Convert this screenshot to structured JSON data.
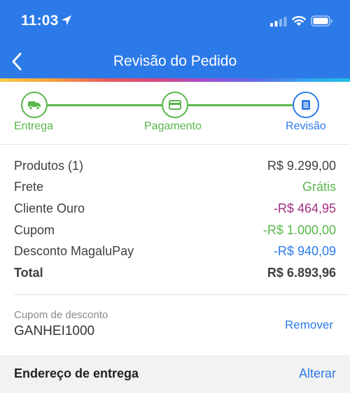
{
  "status_bar": {
    "time": "11:03",
    "icons": [
      "location-arrow-icon",
      "signal-icon",
      "wifi-icon",
      "battery-icon"
    ]
  },
  "header": {
    "title": "Revisão do Pedido",
    "back_icon": "chevron-left-icon",
    "background_color": "#2c7ae8"
  },
  "steps": [
    {
      "label": "Entrega",
      "icon": "truck-icon",
      "state": "done"
    },
    {
      "label": "Pagamento",
      "icon": "credit-card-icon",
      "state": "done"
    },
    {
      "label": "Revisão",
      "icon": "document-icon",
      "state": "current"
    }
  ],
  "summary": {
    "rows": [
      {
        "label": "Produtos (1)",
        "value": "R$ 9.299,00",
        "color": "#404040"
      },
      {
        "label": "Frete",
        "value": "Grátis",
        "color": "#58b64a"
      },
      {
        "label": "Cliente Ouro",
        "value": "-R$ 464,95",
        "color": "#a2307f"
      },
      {
        "label": "Cupom",
        "value": "-R$ 1.000,00",
        "color": "#58b64a"
      },
      {
        "label": "Desconto MagaluPay",
        "value": "-R$ 940,09",
        "color": "#2c7ae8"
      }
    ],
    "total": {
      "label": "Total",
      "value": "R$ 6.893,96"
    }
  },
  "coupon": {
    "label": "Cupom de desconto",
    "code": "GANHEI1000",
    "remove_label": "Remover"
  },
  "address": {
    "title": "Endereço de entrega",
    "change_label": "Alterar"
  },
  "colors": {
    "accent_blue": "#2c7ae8",
    "success_green": "#58b64a",
    "gold_purple": "#a2307f"
  }
}
